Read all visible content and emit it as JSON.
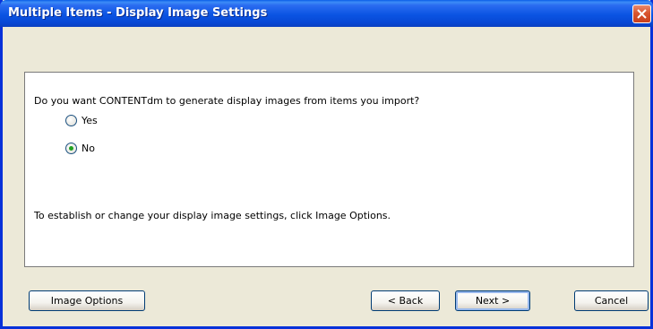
{
  "window": {
    "title": "Multiple Items - Display Image Settings"
  },
  "panel": {
    "question": "Do you want CONTENTdm to generate display images from items you import?",
    "options": [
      {
        "label": "Yes",
        "selected": false
      },
      {
        "label": "No",
        "selected": true
      }
    ],
    "info": "To establish or change your display image settings, click Image Options."
  },
  "buttons": {
    "image_options": "Image Options",
    "back": "< Back",
    "next": "Next >",
    "cancel": "Cancel"
  },
  "icons": {
    "close": "close-icon"
  },
  "colors": {
    "titlebar": "#0b54e3",
    "window_border": "#0831d9",
    "dialog_bg": "#ece9d8",
    "close_button": "#d9552f",
    "radio_selected": "#21a121"
  }
}
